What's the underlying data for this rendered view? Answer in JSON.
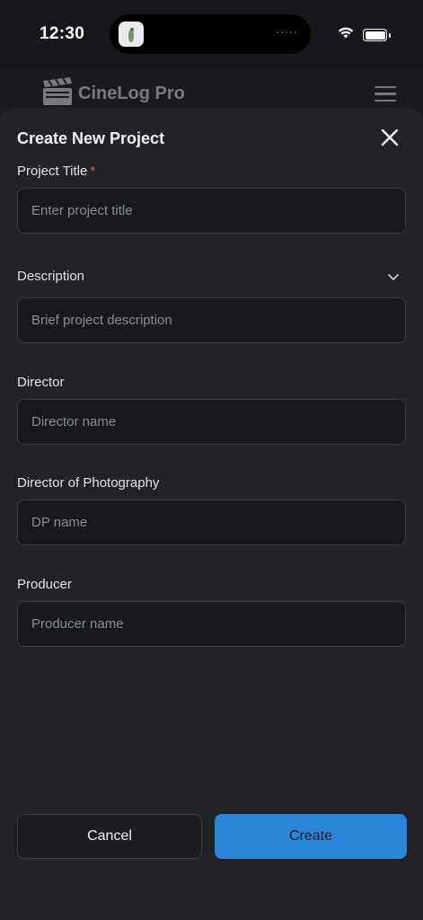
{
  "status_bar": {
    "time": "12:30",
    "island_indicator": "·····",
    "icons": [
      "wifi-icon",
      "battery-icon"
    ]
  },
  "app_header": {
    "title": "CineLog Pro",
    "logo_icon": "clapperboard-icon",
    "menu_icon": "hamburger-menu-icon"
  },
  "modal": {
    "title": "Create New Project",
    "close_icon": "close-icon",
    "fields": {
      "title": {
        "label": "Project Title",
        "required_mark": "*",
        "placeholder": "Enter project title",
        "value": ""
      },
      "description": {
        "label": "Description",
        "placeholder": "Brief project description",
        "value": "",
        "chevron_icon": "chevron-down-icon"
      },
      "director": {
        "label": "Director",
        "placeholder": "Director name",
        "value": ""
      },
      "dp": {
        "label": "Director of Photography",
        "placeholder": "DP name",
        "value": ""
      },
      "producer": {
        "label": "Producer",
        "placeholder": "Producer name",
        "value": ""
      }
    },
    "buttons": {
      "cancel": "Cancel",
      "create": "Create"
    }
  },
  "colors": {
    "accent": "#2b86d9",
    "required": "#e05a52",
    "sheet_bg": "#222327",
    "input_bg": "#18191c"
  }
}
